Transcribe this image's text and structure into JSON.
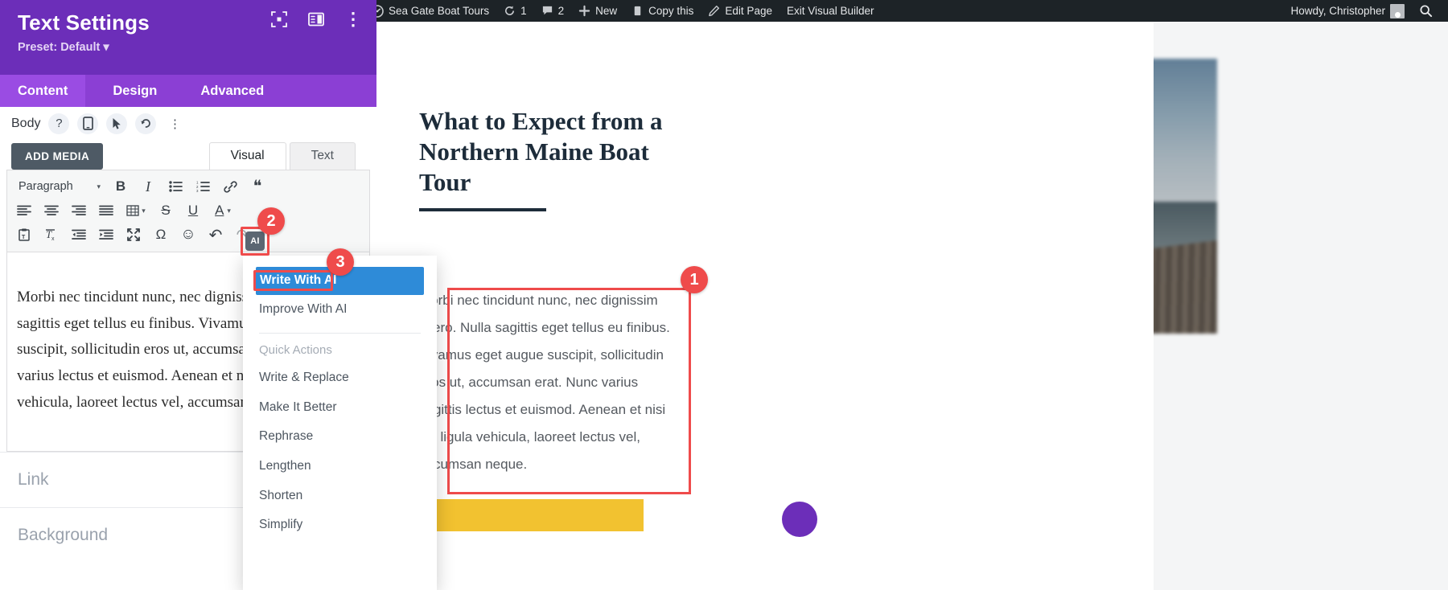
{
  "settings_panel": {
    "title": "Text Settings",
    "preset": "Preset: Default",
    "preset_caret": "▾",
    "icons": {
      "fullscreen": "fullscreen-icon",
      "layout": "panel-layout-icon",
      "more": "⋮"
    },
    "tabs": [
      {
        "label": "Content",
        "active": true
      },
      {
        "label": "Design",
        "active": false
      },
      {
        "label": "Advanced",
        "active": false
      }
    ],
    "body_row": {
      "label": "Body",
      "icons": [
        "help-icon",
        "responsive-icon",
        "hover-icon",
        "reset-icon",
        "more-icon"
      ],
      "help_glyph": "?",
      "more_glyph": "⋮"
    },
    "add_media_label": "ADD MEDIA",
    "editor_tabs": [
      {
        "label": "Visual",
        "active": true
      },
      {
        "label": "Text",
        "active": false
      }
    ],
    "toolbar": {
      "format_select": "Paragraph",
      "row1": [
        "bold",
        "italic",
        "bulleted-list",
        "numbered-list",
        "link",
        "blockquote"
      ],
      "row2": [
        "align-left",
        "align-center",
        "align-right",
        "align-justify",
        "table",
        "strikethrough",
        "underline",
        "text-color"
      ],
      "row3": [
        "paste-as-text",
        "clear-formatting",
        "outdent",
        "indent",
        "fullscreen",
        "special-character",
        "emoji",
        "undo",
        "redo"
      ],
      "bold_glyph": "B",
      "italic_glyph": "I",
      "quote_glyph": "❝",
      "strike_glyph": "S",
      "underline_glyph": "U",
      "textcolor_glyph": "A",
      "omega_glyph": "Ω",
      "emoji_glyph": "☺",
      "undo_glyph": "↶",
      "redo_glyph": "↷",
      "caret_glyph": "▾"
    },
    "editor_body_text": "Morbi nec tincidunt nunc, nec dignissim libero. Nulla sagittis eget tellus eu finibus. Vivamus eget augue suscipit, sollicitudin eros ut, accumsan erat. Nunc varius lectus et euismod. Aenean et nisi vel ligula vehicula, laoreet lectus vel, accumsan neque.",
    "sections": [
      "Link",
      "Background"
    ]
  },
  "ai_button": {
    "label": "AI",
    "name": "ai-assistant-button"
  },
  "ai_menu": {
    "primary": [
      {
        "label": "Write With AI",
        "selected": true
      },
      {
        "label": "Improve With AI",
        "selected": false
      }
    ],
    "group_label": "Quick Actions",
    "quick_actions": [
      "Write & Replace",
      "Make It Better",
      "Rephrase",
      "Lengthen",
      "Shorten",
      "Simplify"
    ]
  },
  "callouts": [
    {
      "number": "1",
      "target": "highlighted-paragraph"
    },
    {
      "number": "2",
      "target": "ai-assistant-button"
    },
    {
      "number": "3",
      "target": "write-with-ai-item"
    }
  ],
  "admin_bar": {
    "left_items": [
      {
        "label": "",
        "icon": "wordpress-logo-icon"
      },
      {
        "label": "Sea Gate Boat Tours",
        "icon": "dashboard-icon"
      },
      {
        "label": "1",
        "icon": "updates-icon"
      },
      {
        "label": "2",
        "icon": "comments-icon"
      },
      {
        "label": "New",
        "icon": "plus-icon"
      },
      {
        "label": "Copy this",
        "icon": "copy-icon"
      },
      {
        "label": "Edit Page",
        "icon": "pencil-icon"
      },
      {
        "label": "Exit Visual Builder",
        "icon": ""
      }
    ],
    "greeting": "Howdy, Christopher",
    "avatar": "user-avatar",
    "search_icon": "search-icon"
  },
  "page": {
    "heading": "What to Expect from a Northern Maine Boat Tour",
    "paragraph": "Morbi nec tincidunt nunc, nec dignissim libero. Nulla sagittis eget tellus eu finibus. Vivamus eget augue suscipit, sollicitudin eros ut, accumsan erat. Nunc varius sagittis lectus et euismod. Aenean et nisi vel ligula vehicula, laoreet lectus vel, accumsan neque.",
    "photo_alt_front": "bird-flying-over-lake-photo",
    "photo_alt_back": "blurred-dock-over-lake-photo"
  },
  "colors": {
    "panel_purple": "#6c2eb9",
    "tab_purple": "#8b3fd4",
    "tab_active_purple": "#9a4ce3",
    "highlight_red": "#ef4b4b",
    "menu_blue": "#2e8bd8",
    "admin_dark": "#1d2327",
    "accent_yellow": "#f2c230",
    "add_media_gray": "#4e5a65"
  }
}
